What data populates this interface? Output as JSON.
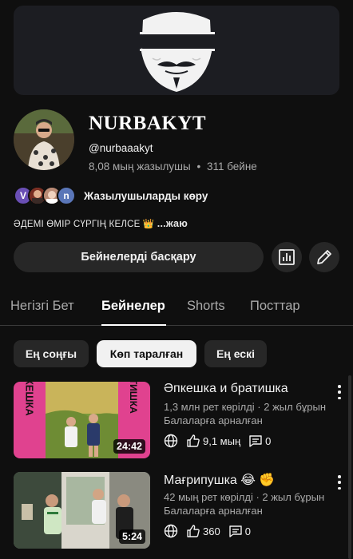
{
  "banner": {
    "icon": "guy-fawkes-mask-icon"
  },
  "channel": {
    "name": "NURBAKYT",
    "handle": "@nurbaaakyt",
    "subscribers": "8,08 мың жазылушы",
    "separator": "•",
    "video_count": "311 бейне",
    "subscribers_link": "Жазылушыларды көру",
    "subscriber_avatars": [
      {
        "letter": "V",
        "color": "#6a4fb5"
      },
      {
        "letter": "",
        "color": "#c4573e"
      },
      {
        "letter": "",
        "color": "#b98a74"
      },
      {
        "letter": "n",
        "color": "#5a76b8"
      }
    ],
    "bio_prefix": "ӘДЕМІ ӨМІР СҮРГІҢ КЕЛСЕ",
    "bio_emoji": "👑",
    "bio_suffix": "...жаю"
  },
  "actions": {
    "manage_videos_label": "Бейнелерді басқару",
    "analytics_icon": "analytics-icon",
    "edit_icon": "pencil-icon"
  },
  "tabs": [
    {
      "label": "Негізгі Бет",
      "active": false
    },
    {
      "label": "Бейнелер",
      "active": true
    },
    {
      "label": "Shorts",
      "active": false
    },
    {
      "label": "Посттар",
      "active": false
    }
  ],
  "filters": [
    {
      "label": "Ең соңғы",
      "active": false
    },
    {
      "label": "Көп таралған",
      "active": true
    },
    {
      "label": "Ең ескі",
      "active": false
    }
  ],
  "videos": [
    {
      "title": "Әпкешка и братишка ",
      "duration": "24:42",
      "meta": "1,3 млн рет көрілді · 2 жыл бұрын",
      "audience": "Балаларға арналған",
      "likes": "9,1 мың",
      "comments": "0",
      "thumb_left_text": "АПКЕШКА",
      "thumb_right_text": "БРАТИШКА"
    },
    {
      "title": "Мағрипушка 😂 ✊",
      "duration": "5:24",
      "meta": "42 мың рет көрілді · 2 жыл бұрын",
      "audience": "Балаларға арналған",
      "likes": "360",
      "comments": "0"
    }
  ],
  "colors": {
    "background": "#0f0f0f",
    "surface": "#272727",
    "text_primary": "#f1f1f1",
    "text_secondary": "#aaaaaa",
    "thumb_accent": "#e0428f"
  }
}
